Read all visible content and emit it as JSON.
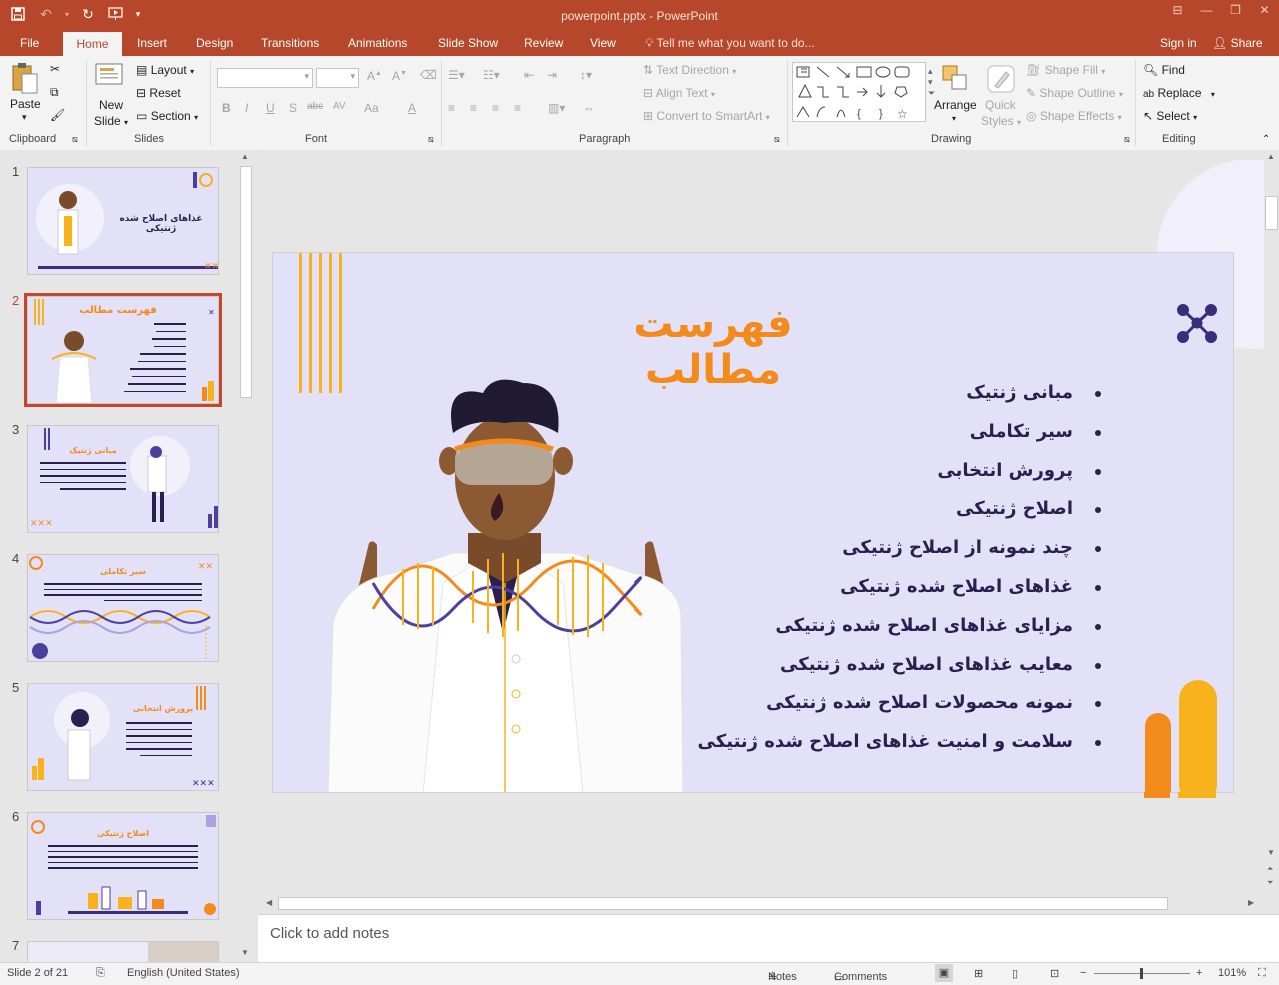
{
  "window": {
    "title": "powerpoint.pptx - PowerPoint",
    "controls": [
      "⊟",
      "—",
      "❐",
      "✕"
    ]
  },
  "ribbon_tabs": [
    {
      "label": "File"
    },
    {
      "label": "Home"
    },
    {
      "label": "Insert"
    },
    {
      "label": "Design"
    },
    {
      "label": "Transitions"
    },
    {
      "label": "Animations"
    },
    {
      "label": "Slide Show"
    },
    {
      "label": "Review"
    },
    {
      "label": "View"
    }
  ],
  "tell_me": "Tell me what you want to do...",
  "sign_in": "Sign in",
  "share": "Share",
  "clipboard": {
    "paste": "Paste",
    "group": "Clipboard"
  },
  "slides_group": {
    "new_slide_1": "New",
    "new_slide_2": "Slide",
    "layout": "Layout",
    "reset": "Reset",
    "section": "Section",
    "group": "Slides"
  },
  "font_group": {
    "group": "Font",
    "bold": "B",
    "italic": "I",
    "underline": "U",
    "shadow": "S",
    "strike": "abc",
    "spacing": "AV",
    "case": "Aa",
    "color": "A"
  },
  "paragraph_group": {
    "group": "Paragraph",
    "text_direction": "Text Direction",
    "align_text": "Align Text",
    "smartart": "Convert to SmartArt"
  },
  "drawing_group": {
    "group": "Drawing",
    "arrange": "Arrange",
    "quick_styles_1": "Quick",
    "quick_styles_2": "Styles",
    "shape_fill": "Shape Fill",
    "shape_outline": "Shape Outline",
    "shape_effects": "Shape Effects"
  },
  "editing_group": {
    "group": "Editing",
    "find": "Find",
    "replace": "Replace",
    "select": "Select"
  },
  "thumbnails": [
    {
      "num": "1",
      "title": "غذاهای اصلاح شده ژنتیکی"
    },
    {
      "num": "2",
      "title": "فهرست مطالب"
    },
    {
      "num": "3",
      "title": "مبانی ژنتیک"
    },
    {
      "num": "4",
      "title": "سیر تکاملی"
    },
    {
      "num": "5",
      "title": "پرورش انتخابی"
    },
    {
      "num": "6",
      "title": "اصلاح ژنتیکی"
    },
    {
      "num": "7",
      "title": ""
    }
  ],
  "slide": {
    "title": "فهرست مطالب",
    "bullets": [
      "مبانی ژنتیک",
      "سیر تکاملی",
      "پرورش انتخابی",
      "اصلاح ژنتیکی",
      "چند نمونه از اصلاح ژنتیکی",
      "غذاهای اصلاح شده ژنتیکی",
      "مزایای غذاهای اصلاح شده ژنتیکی",
      "معایب غذاهای اصلاح شده ژنتیکی",
      "نمونه محصولات اصلاح شده ژنتیکی",
      "سلامت و امنیت غذاهای اصلاح شده ژنتیکی"
    ]
  },
  "notes_placeholder": "Click to add notes",
  "status": {
    "slide_info": "Slide 2 of 21",
    "language": "English (United States)",
    "notes": "Notes",
    "comments": "Comments",
    "zoom": "101%"
  },
  "colors": {
    "brand": "#b7472a",
    "slide_bg": "#e3e1f7",
    "title": "#f28b1a",
    "text": "#2a1f4f",
    "accent_purple": "#4b3fa0",
    "accent_yellow": "#f7b21c"
  }
}
